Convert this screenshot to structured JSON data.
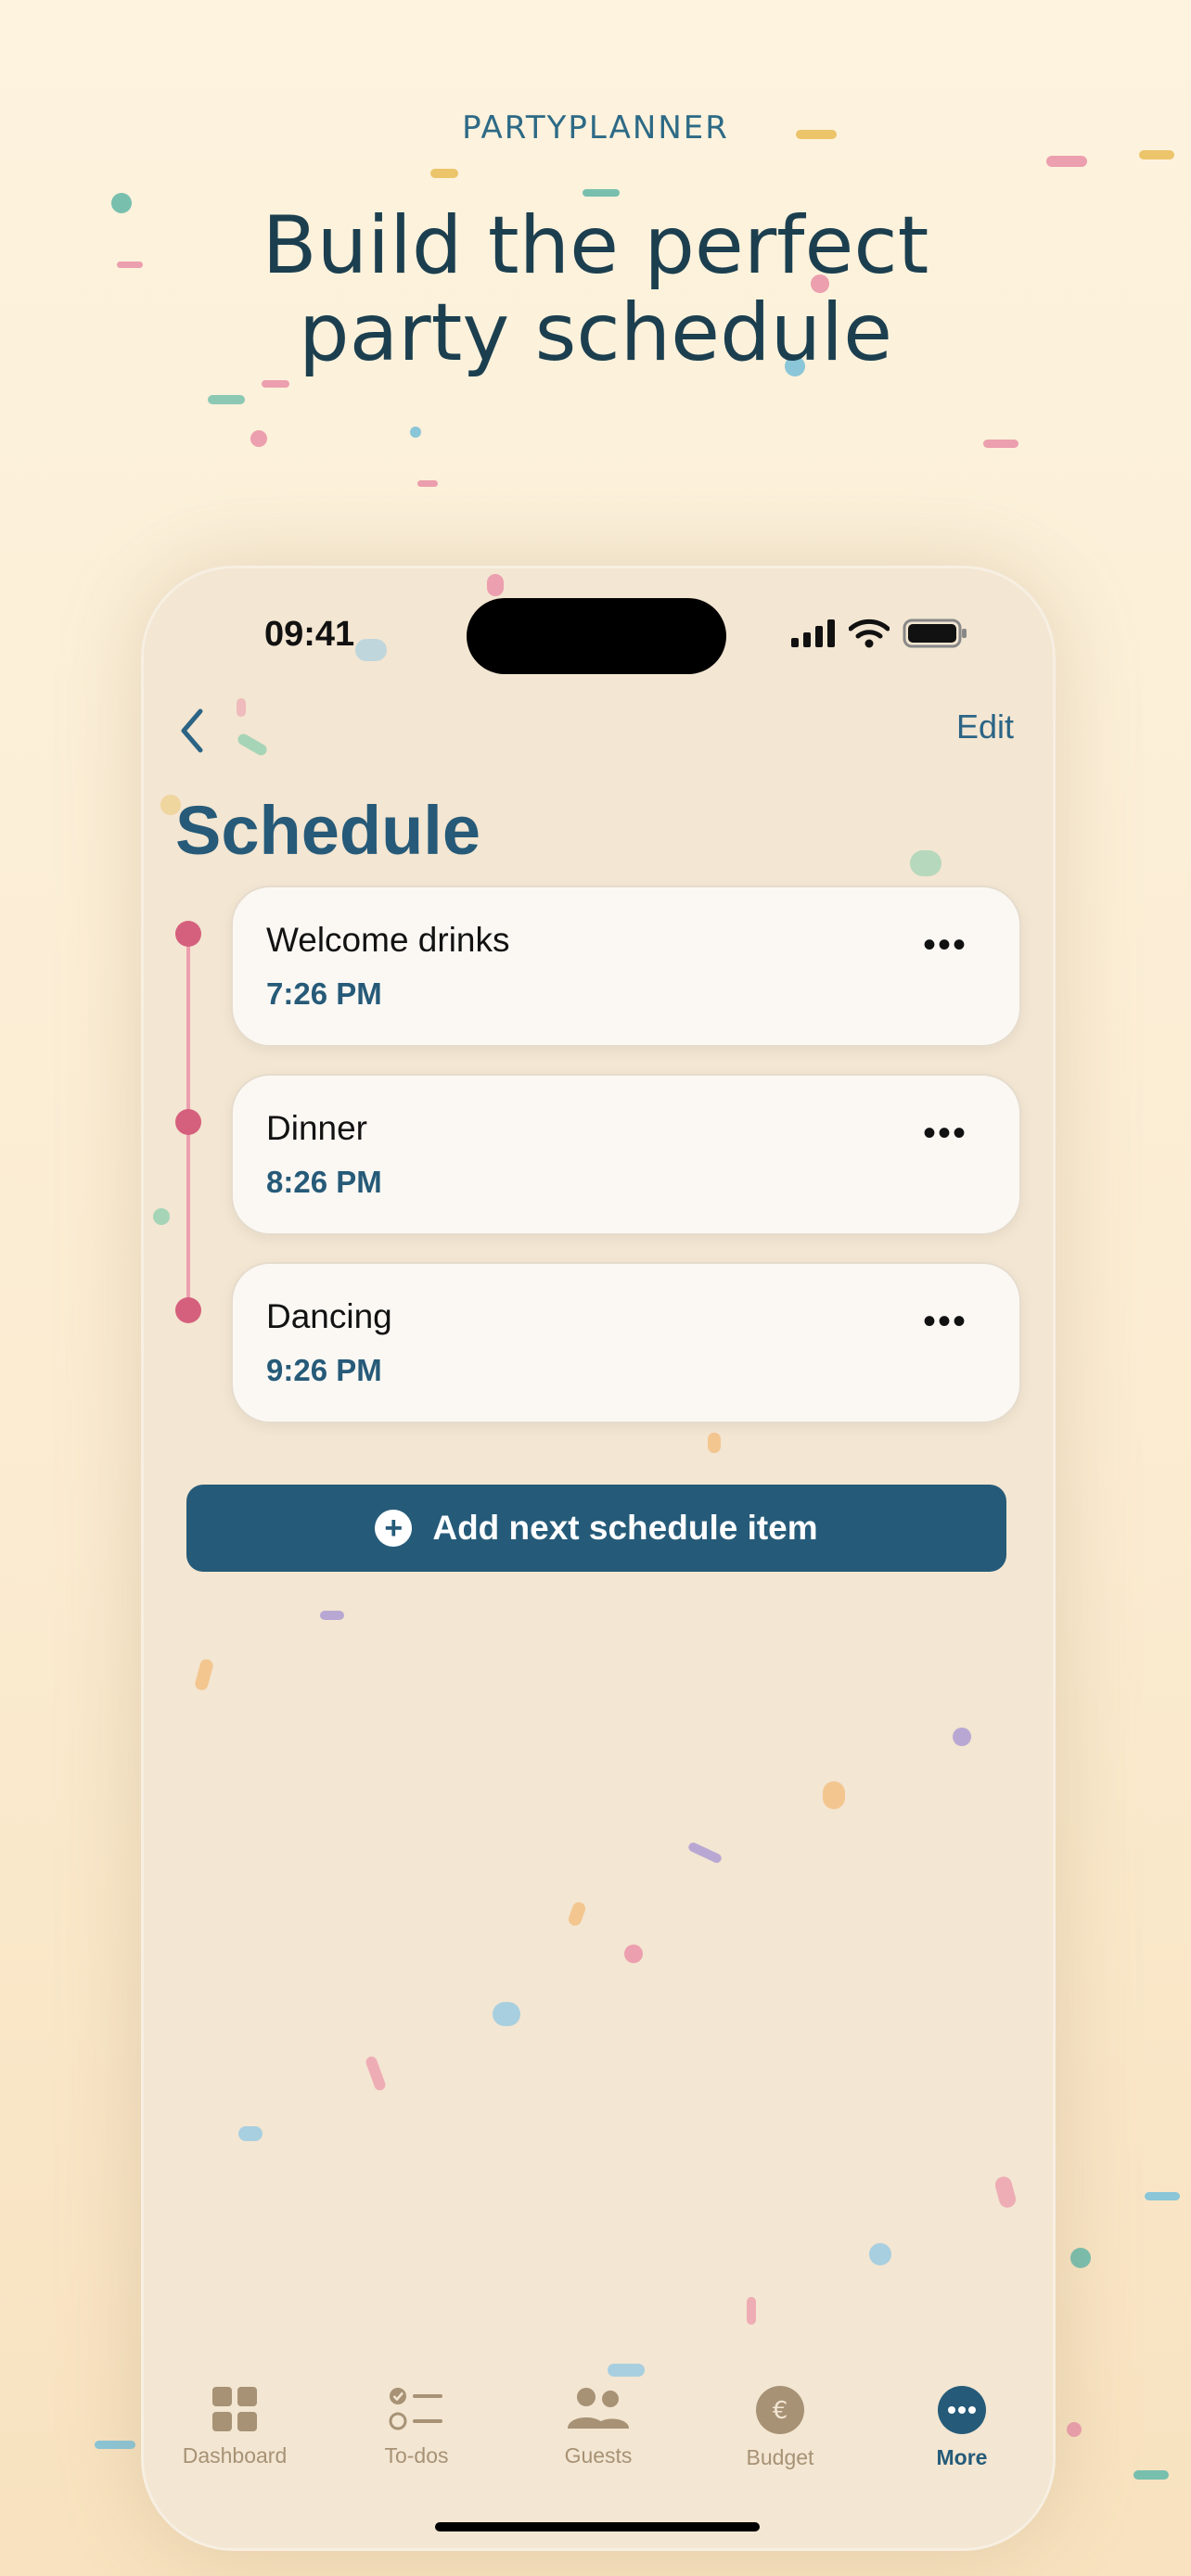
{
  "header": {
    "brand": "PARTYPLANNER",
    "headline_line1": "Build the perfect",
    "headline_line2": "party schedule"
  },
  "status_bar": {
    "time": "09:41"
  },
  "nav": {
    "edit_label": "Edit"
  },
  "page": {
    "title": "Schedule"
  },
  "schedule": [
    {
      "title": "Welcome drinks",
      "time": "7:26 PM"
    },
    {
      "title": "Dinner",
      "time": "8:26 PM"
    },
    {
      "title": "Dancing",
      "time": "9:26 PM"
    }
  ],
  "actions": {
    "add_label": "Add next schedule item"
  },
  "tabbar": {
    "items": [
      {
        "label": "Dashboard",
        "icon": "dashboard-icon"
      },
      {
        "label": "To-dos",
        "icon": "todo-list-icon"
      },
      {
        "label": "Guests",
        "icon": "guests-icon"
      },
      {
        "label": "Budget",
        "icon": "euro-icon"
      },
      {
        "label": "More",
        "icon": "more-icon",
        "active": true
      }
    ]
  },
  "colors": {
    "accent": "#255b79",
    "timeline_dot": "#d5607d",
    "timeline_line": "#ec9fae",
    "inactive_tab": "#a79276"
  }
}
